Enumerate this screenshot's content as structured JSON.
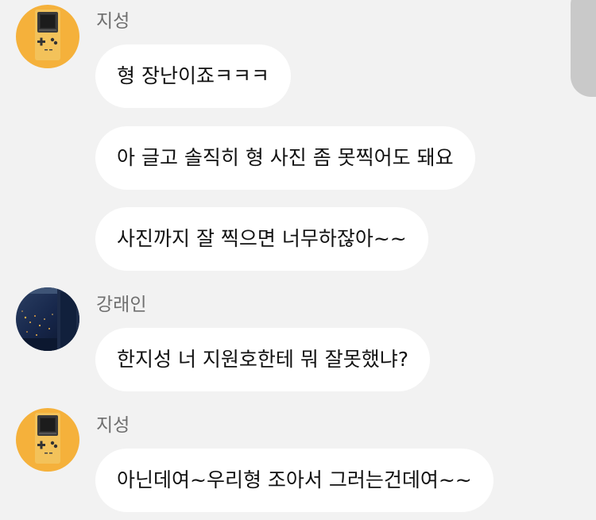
{
  "chat": {
    "groups": [
      {
        "sender": "지성",
        "avatar": "gameboy-avatar",
        "messages": [
          "형 장난이죠ㅋㅋㅋ",
          "아 글고 솔직히 형 사진 좀 못찍어도 돼요",
          "사진까지 잘 찍으면 너무하잖아~~"
        ]
      },
      {
        "sender": "강래인",
        "avatar": "night-city-avatar",
        "messages": [
          "한지성 너 지원호한테 뭐 잘못했냐?"
        ]
      },
      {
        "sender": "지성",
        "avatar": "gameboy-avatar",
        "messages": [
          "아닌데여~우리형 조아서 그러는건데여~~"
        ]
      }
    ]
  },
  "colors": {
    "background": "#f2f2f2",
    "bubble": "#ffffff",
    "gameboy_avatar_bg": "#f5b13b",
    "scrollbar": "#c9c9c9"
  }
}
